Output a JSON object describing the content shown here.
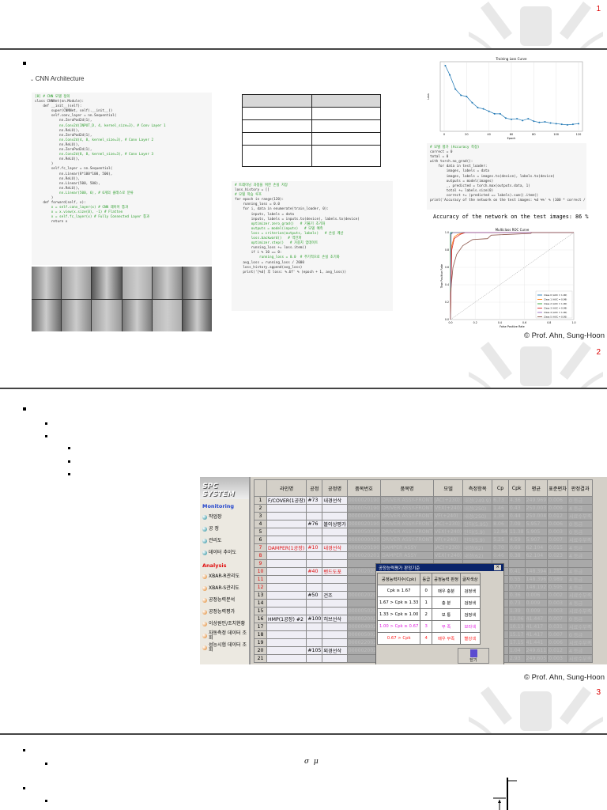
{
  "pages": [
    {
      "number": "1"
    },
    {
      "number": "2"
    },
    {
      "number": "3"
    }
  ],
  "copyright": "© Prof. Ahn, Sung-Hoon",
  "slide1": {
    "section_title": "CNN Architecture",
    "model_code": [
      "[8] # CNN 모델 정의",
      "class CNNNet(nn.Module):",
      "    def __init__(self):",
      "        super(CNNNet, self).__init__()",
      "        self.conv_layer = nn.Sequential(",
      "            nn.ZeroPad2d(1),",
      "            nn.Conv2d(INPUT_D, 4, kernel_size=3), # Conv Layer 1",
      "            nn.ReLU(),",
      "            nn.ZeroPad2d(1),",
      "            nn.Conv2d(4, 8, kernel_size=3), # Conv Layer 2",
      "            nn.ReLU(),",
      "            nn.ZeroPad2d(1),",
      "            nn.Conv2d(8, 8, kernel_size=3), # Conv Layer 3",
      "            nn.ReLU(),",
      "        )",
      "",
      "        self.fc_layer = nn.Sequential(",
      "            nn.Linear(8*100*100, 500),",
      "            nn.ReLU(),",
      "            nn.Linear(500, 500),",
      "            nn.ReLU(),",
      "            nn.Linear(500, 6), # 6개의 클래스로 분류",
      "        )",
      "",
      "    def forward(self, x):",
      "        x = self.conv_layer(x) # CNN 레이어 통과",
      "        x = x.view(x.size(0), -1) # Flatten",
      "        x = self.fc_layer(x) # Fully Connected Layer 통과",
      "        return x"
    ],
    "train_code": [
      "# 트레이닝 과정을 위한 손실 저장",
      "loss_history = []",
      "",
      "# 모델 학습 루프",
      "for epoch in range(120):",
      "    running_loss = 0.0",
      "    for i, data in enumerate(train_loader, 0):",
      "        inputs, labels = data",
      "        inputs, labels = inputs.to(device), labels.to(device)",
      "",
      "        optimizer.zero_grad()   # 기울기 초기화",
      "        outputs = model(inputs)   # 모델 예측",
      "        loss = criterion(outputs, labels)   # 손실 계산",
      "        loss.backward()   # 역전파",
      "        optimizer.step()   # 가중치 업데이트",
      "",
      "        running_loss += loss.item()",
      "",
      "        if i % 10 == 0:",
      "            running_loss = 0.0  # 주기적으로 손실 초기화",
      "",
      "    avg_loss = running_loss / 2000",
      "    loss_history.append(avg_loss)",
      "    print('[%d] 후 loss: %.6f' % (epoch + 1, avg_loss))"
    ],
    "eval_code": [
      "# 모델 평가 (Accuracy 측정)",
      "correct = 0",
      "total = 0",
      "with torch.no_grad():",
      "    for data in test_loader:",
      "        images, labels = data",
      "        images, labels = images.to(device), labels.to(device)",
      "        outputs = model(images)",
      "        _, predicted = torch.max(outputs.data, 1)",
      "        total += labels.size(0)",
      "        correct += (predicted == labels).sum().item()",
      "",
      "print('Accuracy of the network on the test images: %d %%' % (100 * correct / total))"
    ],
    "accuracy_output": "Accuracy of the network on the test images: 86 %",
    "loss_chart": {
      "title": "Training Loss Curve",
      "xlabel": "Epoch",
      "ylabel": "Loss",
      "xticks": [
        "0",
        "20",
        "40",
        "60",
        "80",
        "100",
        "120"
      ]
    },
    "roc_chart": {
      "title": "Multiclass ROC Curve",
      "xlabel": "False Positive Rate",
      "ylabel": "True Positive Rate",
      "ticks": [
        "0.0",
        "0.2",
        "0.4",
        "0.6",
        "0.8",
        "1.0"
      ],
      "legend": [
        "Class 0 (AUC = 1.00)",
        "Class 1 (AUC = 0.99)",
        "Class 2 (AUC = 1.00)",
        "Class 3 (AUC = 0.99)",
        "Class 4 (AUC = 1.00)",
        "Class 5 (AUC = 0.95)"
      ],
      "colors": [
        "#1f77b4",
        "#ff7f0e",
        "#2ca02c",
        "#d62728",
        "#9467bd",
        "#8c564b"
      ]
    }
  },
  "chart_data": {
    "type": "line",
    "title": "Training Loss Curve",
    "xlabel": "Epoch",
    "ylabel": "Loss",
    "x": [
      1,
      5,
      10,
      15,
      20,
      25,
      30,
      35,
      40,
      45,
      50,
      55,
      60,
      65,
      70,
      75,
      80,
      85,
      90,
      95,
      100,
      105,
      110,
      115,
      120
    ],
    "values": [
      1.0,
      0.85,
      0.62,
      0.52,
      0.5,
      0.4,
      0.32,
      0.3,
      0.26,
      0.22,
      0.22,
      0.15,
      0.13,
      0.14,
      0.11,
      0.14,
      0.1,
      0.08,
      0.09,
      0.07,
      0.06,
      0.05,
      0.04,
      0.05,
      0.06
    ]
  },
  "slide2": {
    "spc": {
      "logo": "SPC SYSTEM",
      "monitoring": "Monitoring",
      "analysis": "Analysis",
      "monitoring_items": [
        "작업장",
        "공 정",
        "관리도",
        "데이터 추이도"
      ],
      "analysis_items": [
        "XBAR-R관리도",
        "XBAR-S관리도",
        "공정능력분석",
        "공정능력평가",
        "이상원인/조치현황",
        "자동측정 데이터 조회",
        "성능시험 데이터 조회"
      ],
      "columns": [
        "",
        "라인명",
        "공정",
        "공정명",
        "품목번호",
        "품목명",
        "모델",
        "측정항목",
        "Cp",
        "Cpk",
        "평균",
        "표준편차",
        "판정결과"
      ],
      "rows": [
        [
          "1",
          "F/COVER(1공장)",
          "#73",
          "내경선삭",
          "0000020190",
          "DRIVER ASSY-FRONT",
          "JAC(+230)",
          "내경(249.9)",
          "6.73",
          "4.36",
          "249.969",
          "0.006",
          "0 등급"
        ],
        [
          "2",
          "",
          "",
          "",
          "0000050190",
          "DRIVER ASSY-FRONT",
          "VEX(+240)",
          "내경(250)",
          "1.46",
          "0.43",
          "250.003",
          "0.009",
          "4 등급"
        ],
        [
          "3",
          "",
          "",
          "",
          "0000000020",
          "DRIVER ASSY-FRONT",
          "VF(+240)",
          "내경(250)",
          "1.38",
          "0.44",
          "250.004",
          "0.012",
          "시료수부족"
        ],
        [
          "4",
          "",
          "#76",
          "볼이상평가",
          "0000020190",
          "DRIVER ASSY-FRONT",
          "JAC(+230)",
          "단차(5.95)",
          "8.06",
          "7.09",
          "5.957",
          "0.006",
          "0 등급"
        ],
        [
          "5",
          "",
          "",
          "",
          "0000050190",
          "DRIVER ASSY-FRONT",
          "VEX(+240)",
          "단차(5.9)",
          "12.84",
          "11.38",
          "5.905",
          "0.003",
          "0 등급"
        ],
        [
          "6",
          "",
          "",
          "",
          "0000000020",
          "DRIVER ASSY-FRONT",
          "VF(+240)",
          "단차(5.9)",
          "5.25",
          "4.59",
          "5.907",
          "0.007",
          "시료수부족"
        ],
        [
          "7",
          "DAMPER(1공장)",
          "#10",
          "내경선삭",
          "0000020190",
          "DAMPER ASSY",
          "JAC(+230)",
          "내경(62)",
          "0.70",
          "0.69",
          "62.104",
          "0.015",
          "4 등급"
        ],
        [
          "8",
          "",
          "",
          "",
          "0000020201",
          "DAMPER ASSY",
          "VEX(+240)",
          "내경(62)",
          "0.46",
          "0.38",
          "62.104",
          "0.023",
          "4 등급"
        ],
        [
          "9",
          "",
          "",
          "",
          "",
          "",
          "",
          "",
          "",
          "",
          "",
          "",
          ""
        ],
        [
          "10",
          "",
          "#40",
          "밴드도포",
          "0000020200",
          "DAMPER",
          "",
          "",
          "",
          "0.41",
          "148.394",
          "1.282",
          "4 등급"
        ],
        [
          "11",
          "",
          "",
          "",
          "",
          "DAMPER",
          "",
          "",
          "",
          "0.55",
          "148.396",
          "0.989",
          "4 등급"
        ],
        [
          "12",
          "",
          "",
          "",
          "",
          "DAMPER",
          "",
          "",
          "",
          "0.73",
          "148.192",
          "0.595",
          "4 등급"
        ],
        [
          "13",
          "",
          "#50",
          "건조",
          "0000020290",
          "DAMPER",
          "",
          "",
          "",
          "0.36",
          "0.006",
          "0.002",
          "시료수부족"
        ],
        [
          "14",
          "",
          "",
          "",
          "",
          "DAMPER",
          "",
          "",
          "",
          "0.73",
          "0.009",
          "0.003",
          "4 등급"
        ],
        [
          "15",
          "",
          "",
          "",
          "0000050290",
          "DAMPER",
          "",
          "",
          "",
          "1.39",
          "0.009",
          "0.003",
          "시료수부족"
        ],
        [
          "16",
          "HMP(1공장) #2",
          "#100",
          "허브선삭",
          "0000020020",
          "HUB",
          "",
          "",
          "",
          "13.06",
          "41.447",
          "0.007",
          "0 등급"
        ],
        [
          "17",
          "",
          "",
          "",
          "0000040020",
          "HUB",
          "",
          "",
          "",
          "10.13",
          "41.417",
          "0.031",
          "시료수부족"
        ],
        [
          "18",
          "",
          "",
          "",
          "0000050020",
          "HUB",
          "",
          "",
          "",
          "15.17",
          "41.417",
          "0.007",
          "0 등급"
        ],
        [
          "19",
          "",
          "",
          "",
          "0000220020",
          "HUB",
          "",
          "",
          "",
          "17.15",
          "41.441",
          "0.006",
          "시료수부족"
        ],
        [
          "20",
          "",
          "#105",
          "외경선삭",
          "0000020020",
          "HUB",
          "",
          "",
          "",
          "1.04",
          "249.611",
          "0.012",
          "4 등급"
        ],
        [
          "21",
          "",
          "",
          "",
          "",
          "",
          "",
          "",
          "",
          "2.93",
          "249.605",
          "0.003",
          "시료수부족"
        ]
      ],
      "dialog": {
        "title": "공정능력평가 판정기준",
        "headers": [
          "공정능력지수(Cpk)",
          "등급",
          "공정능력 판정",
          "글자색상"
        ],
        "rows": [
          [
            "Cpk ≥ 1.67",
            "0",
            "매우 충분",
            "검정색"
          ],
          [
            "1.67 > Cpk ≥ 1.33",
            "1",
            "충 분",
            "검정색"
          ],
          [
            "1.33 > Cpk ≥ 1.00",
            "2",
            "보 통",
            "검정색"
          ],
          [
            "1.00 > Cpk ≥ 0.67",
            "3",
            "부 족",
            "보라색"
          ],
          [
            "0.67 > Cpk",
            "4",
            "매우 부족",
            "빨강색"
          ]
        ],
        "row_colors": [
          "#000000",
          "#000000",
          "#000000",
          "#e020e0",
          "#ff2020"
        ],
        "close_label": "닫기"
      }
    }
  },
  "slide3": {
    "sigma": "σ",
    "mu": "μ"
  }
}
